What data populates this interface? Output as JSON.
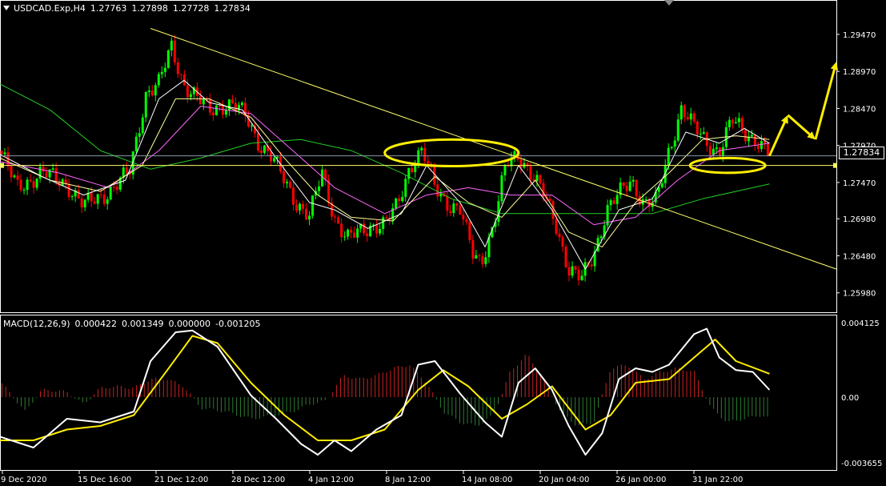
{
  "header": {
    "symbol": "USDCAD.Exp,H4",
    "open": "1.27763",
    "high": "1.27898",
    "low": "1.27728",
    "close": "1.27834"
  },
  "current_price": "1.27834",
  "macd_header": {
    "name": "MACD(12,26,9)",
    "v1": "0.000422",
    "v2": "0.001349",
    "v3": "0.000000",
    "v4": "-0.001205"
  },
  "colors": {
    "background": "#000000",
    "bull": "#00ff00",
    "bear": "#ff0000",
    "trendline": "#ffff66",
    "annotation": "#ffee00",
    "ma_fast": "#ffffff",
    "ma_mid": "#ffff99",
    "ma_slow": "#ff66ff",
    "ma_long": "#22cc22",
    "macd_line": "#ffffff",
    "signal_line": "#ffee00",
    "hist_pos": "#cc2222",
    "hist_neg": "#2e7d32"
  },
  "chart_data": [
    {
      "type": "candlestick",
      "title": "USDCAD.Exp,H4",
      "x_tick_labels": [
        "9 Dec 2020",
        "15 Dec 16:00",
        "21 Dec 12:00",
        "28 Dec 12:00",
        "4 Jan 12:00",
        "8 Jan 12:00",
        "14 Jan 08:00",
        "20 Jan 04:00",
        "26 Jan 00:00",
        "31 Jan 22:00"
      ],
      "y_tick_labels": [
        "1.29470",
        "1.28970",
        "1.28470",
        "1.27970",
        "1.27470",
        "1.26980",
        "1.26480",
        "1.25980"
      ],
      "ylim": [
        1.2575,
        1.2975
      ],
      "horizontal_lines": [
        1.2783,
        1.277
      ],
      "trendline": {
        "from": [
          0.18,
          1.2955
        ],
        "to": [
          1.0,
          1.263
        ]
      },
      "path": [
        [
          0.0,
          1.279
        ],
        [
          0.02,
          1.274
        ],
        [
          0.05,
          1.276
        ],
        [
          0.08,
          1.2745
        ],
        [
          0.1,
          1.2715
        ],
        [
          0.13,
          1.2735
        ],
        [
          0.155,
          1.276
        ],
        [
          0.175,
          1.287
        ],
        [
          0.19,
          1.288
        ],
        [
          0.205,
          1.293
        ],
        [
          0.22,
          1.288
        ],
        [
          0.235,
          1.286
        ],
        [
          0.25,
          1.2845
        ],
        [
          0.265,
          1.2852
        ],
        [
          0.28,
          1.285
        ],
        [
          0.295,
          1.2835
        ],
        [
          0.31,
          1.28
        ],
        [
          0.325,
          1.278
        ],
        [
          0.34,
          1.275
        ],
        [
          0.355,
          1.272
        ],
        [
          0.37,
          1.27
        ],
        [
          0.385,
          1.276
        ],
        [
          0.4,
          1.27
        ],
        [
          0.415,
          1.267
        ],
        [
          0.43,
          1.268
        ],
        [
          0.445,
          1.269
        ],
        [
          0.46,
          1.269
        ],
        [
          0.475,
          1.2715
        ],
        [
          0.49,
          1.277
        ],
        [
          0.505,
          1.279
        ],
        [
          0.52,
          1.274
        ],
        [
          0.535,
          1.272
        ],
        [
          0.55,
          1.271
        ],
        [
          0.565,
          1.265
        ],
        [
          0.575,
          1.264
        ],
        [
          0.59,
          1.269
        ],
        [
          0.605,
          1.277
        ],
        [
          0.62,
          1.2785
        ],
        [
          0.635,
          1.276
        ],
        [
          0.65,
          1.273
        ],
        [
          0.665,
          1.269
        ],
        [
          0.68,
          1.263
        ],
        [
          0.695,
          1.2615
        ],
        [
          0.71,
          1.265
        ],
        [
          0.725,
          1.271
        ],
        [
          0.74,
          1.273
        ],
        [
          0.755,
          1.275
        ],
        [
          0.77,
          1.272
        ],
        [
          0.785,
          1.272
        ],
        [
          0.8,
          1.279
        ],
        [
          0.815,
          1.285
        ],
        [
          0.83,
          1.282
        ],
        [
          0.845,
          1.28
        ],
        [
          0.86,
          1.279
        ],
        [
          0.875,
          1.283
        ],
        [
          0.89,
          1.2815
        ],
        [
          0.905,
          1.2805
        ],
        [
          0.92,
          1.2783
        ]
      ],
      "ma_curves": {
        "fast": [
          [
            0.0,
            1.2785
          ],
          [
            0.05,
            1.2755
          ],
          [
            0.1,
            1.273
          ],
          [
            0.15,
            1.275
          ],
          [
            0.19,
            1.286
          ],
          [
            0.22,
            1.2885
          ],
          [
            0.25,
            1.2855
          ],
          [
            0.29,
            1.2845
          ],
          [
            0.33,
            1.278
          ],
          [
            0.37,
            1.272
          ],
          [
            0.4,
            1.271
          ],
          [
            0.44,
            1.2685
          ],
          [
            0.48,
            1.2705
          ],
          [
            0.51,
            1.277
          ],
          [
            0.55,
            1.272
          ],
          [
            0.58,
            1.266
          ],
          [
            0.62,
            1.277
          ],
          [
            0.66,
            1.271
          ],
          [
            0.7,
            1.263
          ],
          [
            0.74,
            1.271
          ],
          [
            0.78,
            1.2725
          ],
          [
            0.82,
            1.2815
          ],
          [
            0.86,
            1.28
          ],
          [
            0.89,
            1.282
          ],
          [
            0.92,
            1.28
          ]
        ],
        "mid": [
          [
            0.0,
            1.278
          ],
          [
            0.06,
            1.275
          ],
          [
            0.12,
            1.2735
          ],
          [
            0.17,
            1.277
          ],
          [
            0.21,
            1.286
          ],
          [
            0.25,
            1.286
          ],
          [
            0.3,
            1.2835
          ],
          [
            0.34,
            1.278
          ],
          [
            0.38,
            1.273
          ],
          [
            0.42,
            1.27
          ],
          [
            0.47,
            1.2695
          ],
          [
            0.52,
            1.2755
          ],
          [
            0.56,
            1.272
          ],
          [
            0.6,
            1.27
          ],
          [
            0.64,
            1.275
          ],
          [
            0.68,
            1.268
          ],
          [
            0.72,
            1.266
          ],
          [
            0.76,
            1.272
          ],
          [
            0.8,
            1.276
          ],
          [
            0.84,
            1.2805
          ],
          [
            0.88,
            1.281
          ],
          [
            0.92,
            1.2805
          ]
        ],
        "slow": [
          [
            0.0,
            1.2775
          ],
          [
            0.07,
            1.276
          ],
          [
            0.13,
            1.274
          ],
          [
            0.19,
            1.279
          ],
          [
            0.24,
            1.285
          ],
          [
            0.3,
            1.284
          ],
          [
            0.35,
            1.279
          ],
          [
            0.4,
            1.274
          ],
          [
            0.46,
            1.2705
          ],
          [
            0.51,
            1.273
          ],
          [
            0.56,
            1.274
          ],
          [
            0.61,
            1.273
          ],
          [
            0.66,
            1.273
          ],
          [
            0.71,
            1.269
          ],
          [
            0.76,
            1.27
          ],
          [
            0.81,
            1.275
          ],
          [
            0.86,
            1.279
          ],
          [
            0.92,
            1.28
          ]
        ],
        "long": [
          [
            0.0,
            1.288
          ],
          [
            0.06,
            1.2845
          ],
          [
            0.12,
            1.279
          ],
          [
            0.18,
            1.2765
          ],
          [
            0.24,
            1.278
          ],
          [
            0.3,
            1.28
          ],
          [
            0.36,
            1.2805
          ],
          [
            0.42,
            1.279
          ],
          [
            0.48,
            1.276
          ],
          [
            0.54,
            1.2725
          ],
          [
            0.6,
            1.2705
          ],
          [
            0.66,
            1.2705
          ],
          [
            0.72,
            1.2705
          ],
          [
            0.78,
            1.2705
          ],
          [
            0.84,
            1.2725
          ],
          [
            0.92,
            1.2745
          ]
        ]
      },
      "annotations": {
        "ellipses": [
          {
            "cx": 0.54,
            "cy": 1.2787,
            "rx": 0.08,
            "ry": 0.0018
          },
          {
            "cx": 0.87,
            "cy": 1.277,
            "rx": 0.045,
            "ry": 0.001
          }
        ],
        "arrow_path": [
          [
            0.92,
            1.2783
          ],
          [
            0.942,
            1.2838
          ],
          [
            0.975,
            1.2805
          ],
          [
            1.0,
            1.291
          ]
        ]
      }
    },
    {
      "type": "macd",
      "title": "MACD(12,26,9)",
      "y_tick_labels": [
        "0.004125",
        "0.00",
        "-0.003655"
      ],
      "ylim": [
        -0.004,
        0.0044
      ],
      "macd_line": [
        [
          0.0,
          -0.0022
        ],
        [
          0.04,
          -0.0028
        ],
        [
          0.08,
          -0.0012
        ],
        [
          0.12,
          -0.0014
        ],
        [
          0.16,
          -0.0008
        ],
        [
          0.18,
          0.002
        ],
        [
          0.21,
          0.0036
        ],
        [
          0.23,
          0.0037
        ],
        [
          0.26,
          0.0028
        ],
        [
          0.3,
          0.0001
        ],
        [
          0.33,
          -0.0012
        ],
        [
          0.36,
          -0.0026
        ],
        [
          0.38,
          -0.0032
        ],
        [
          0.4,
          -0.0024
        ],
        [
          0.42,
          -0.003
        ],
        [
          0.45,
          -0.0018
        ],
        [
          0.48,
          -0.001
        ],
        [
          0.5,
          0.0018
        ],
        [
          0.52,
          0.002
        ],
        [
          0.55,
          0.0002
        ],
        [
          0.58,
          -0.0014
        ],
        [
          0.6,
          -0.0022
        ],
        [
          0.62,
          0.0008
        ],
        [
          0.64,
          0.0016
        ],
        [
          0.66,
          0.0004
        ],
        [
          0.68,
          -0.0016
        ],
        [
          0.7,
          -0.0032
        ],
        [
          0.72,
          -0.002
        ],
        [
          0.74,
          0.001
        ],
        [
          0.76,
          0.0016
        ],
        [
          0.78,
          0.0014
        ],
        [
          0.8,
          0.0018
        ],
        [
          0.83,
          0.0035
        ],
        [
          0.845,
          0.0038
        ],
        [
          0.86,
          0.0022
        ],
        [
          0.88,
          0.0015
        ],
        [
          0.9,
          0.0014
        ],
        [
          0.92,
          0.0004
        ]
      ],
      "signal_line": [
        [
          0.0,
          -0.0024
        ],
        [
          0.04,
          -0.0024
        ],
        [
          0.08,
          -0.0018
        ],
        [
          0.12,
          -0.0016
        ],
        [
          0.16,
          -0.001
        ],
        [
          0.2,
          0.0015
        ],
        [
          0.23,
          0.0034
        ],
        [
          0.26,
          0.003
        ],
        [
          0.3,
          0.0008
        ],
        [
          0.34,
          -0.001
        ],
        [
          0.38,
          -0.0024
        ],
        [
          0.42,
          -0.0024
        ],
        [
          0.46,
          -0.0018
        ],
        [
          0.5,
          0.0004
        ],
        [
          0.53,
          0.0015
        ],
        [
          0.56,
          0.0006
        ],
        [
          0.6,
          -0.0012
        ],
        [
          0.63,
          -0.0004
        ],
        [
          0.66,
          0.0006
        ],
        [
          0.7,
          -0.0018
        ],
        [
          0.73,
          -0.001
        ],
        [
          0.76,
          0.0008
        ],
        [
          0.8,
          0.001
        ],
        [
          0.83,
          0.0022
        ],
        [
          0.855,
          0.0032
        ],
        [
          0.88,
          0.002
        ],
        [
          0.92,
          0.0013
        ]
      ],
      "histogram": [
        [
          0.0,
          0.0009
        ],
        [
          0.03,
          -0.0008
        ],
        [
          0.05,
          0.0004
        ],
        [
          0.08,
          0.0003
        ],
        [
          0.1,
          -0.0004
        ],
        [
          0.12,
          0.0005
        ],
        [
          0.14,
          0.0006
        ],
        [
          0.16,
          0.0005
        ],
        [
          0.18,
          0.001
        ],
        [
          0.2,
          0.001
        ],
        [
          0.22,
          0.0006
        ],
        [
          0.24,
          -0.0006
        ],
        [
          0.27,
          -0.0008
        ],
        [
          0.3,
          -0.0012
        ],
        [
          0.33,
          -0.001
        ],
        [
          0.35,
          -0.0008
        ],
        [
          0.37,
          -0.0004
        ],
        [
          0.39,
          -0.0002
        ],
        [
          0.41,
          0.0012
        ],
        [
          0.43,
          0.001
        ],
        [
          0.45,
          0.0012
        ],
        [
          0.47,
          0.0016
        ],
        [
          0.49,
          0.0018
        ],
        [
          0.51,
          0.0008
        ],
        [
          0.53,
          -0.0008
        ],
        [
          0.55,
          -0.0014
        ],
        [
          0.57,
          -0.0016
        ],
        [
          0.59,
          -0.001
        ],
        [
          0.61,
          0.0014
        ],
        [
          0.63,
          0.0024
        ],
        [
          0.65,
          0.001
        ],
        [
          0.67,
          -0.0008
        ],
        [
          0.69,
          -0.0016
        ],
        [
          0.71,
          -0.0014
        ],
        [
          0.73,
          0.0016
        ],
        [
          0.75,
          0.0018
        ],
        [
          0.77,
          0.001
        ],
        [
          0.79,
          0.0014
        ],
        [
          0.81,
          0.0016
        ],
        [
          0.83,
          0.0014
        ],
        [
          0.85,
          -0.0006
        ],
        [
          0.87,
          -0.0014
        ],
        [
          0.89,
          -0.0012
        ],
        [
          0.91,
          -0.001
        ],
        [
          0.92,
          -0.0012
        ]
      ]
    }
  ]
}
